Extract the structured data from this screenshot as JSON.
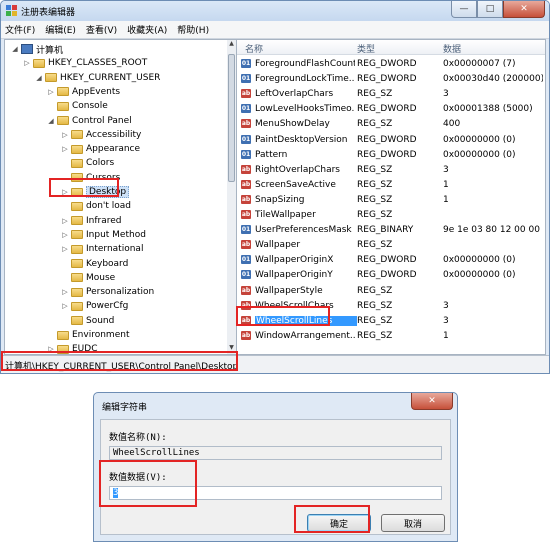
{
  "window": {
    "title": "注册表编辑器",
    "buttons": {
      "minimize": "—",
      "maximize": "□",
      "close": "✕"
    }
  },
  "menu": [
    "文件(F)",
    "编辑(E)",
    "查看(V)",
    "收藏夹(A)",
    "帮助(H)"
  ],
  "tree": [
    {
      "label": "计算机",
      "expander": "◢",
      "icon": "computer-icon"
    },
    {
      "label": "HKEY_CLASSES_ROOT",
      "expander": "▷",
      "icon": "folder-icon"
    },
    {
      "label": "HKEY_CURRENT_USER",
      "expander": "◢",
      "icon": "folder-icon"
    },
    {
      "label": "AppEvents",
      "expander": "▷",
      "icon": "folder-icon"
    },
    {
      "label": "Console",
      "expander": "",
      "icon": "folder-icon"
    },
    {
      "label": "Control Panel",
      "expander": "◢",
      "icon": "folder-icon"
    },
    {
      "label": "Accessibility",
      "expander": "▷",
      "icon": "folder-icon"
    },
    {
      "label": "Appearance",
      "expander": "▷",
      "icon": "folder-icon"
    },
    {
      "label": "Colors",
      "expander": "",
      "icon": "folder-icon"
    },
    {
      "label": "Cursors",
      "expander": "",
      "icon": "folder-icon"
    },
    {
      "label": "Desktop",
      "expander": "▷",
      "icon": "folder-icon",
      "selected": true
    },
    {
      "label": "don't load",
      "expander": "",
      "icon": "folder-icon"
    },
    {
      "label": "Infrared",
      "expander": "▷",
      "icon": "folder-icon"
    },
    {
      "label": "Input Method",
      "expander": "▷",
      "icon": "folder-icon"
    },
    {
      "label": "International",
      "expander": "▷",
      "icon": "folder-icon"
    },
    {
      "label": "Keyboard",
      "expander": "",
      "icon": "folder-icon"
    },
    {
      "label": "Mouse",
      "expander": "",
      "icon": "folder-icon"
    },
    {
      "label": "Personalization",
      "expander": "▷",
      "icon": "folder-icon"
    },
    {
      "label": "PowerCfg",
      "expander": "▷",
      "icon": "folder-icon"
    },
    {
      "label": "Sound",
      "expander": "",
      "icon": "folder-icon"
    },
    {
      "label": "Environment",
      "expander": "",
      "icon": "folder-icon"
    },
    {
      "label": "EUDC",
      "expander": "▷",
      "icon": "folder-icon"
    }
  ],
  "list": {
    "columns": {
      "name": "名称",
      "type": "类型",
      "data": "数据"
    },
    "rows": [
      {
        "icon": "binary-value-icon",
        "name": "ForegroundFlashCount",
        "type": "REG_DWORD",
        "data": "0x00000007 (7)"
      },
      {
        "icon": "binary-value-icon",
        "name": "ForegroundLockTime...",
        "type": "REG_DWORD",
        "data": "0x00030d40 (200000)"
      },
      {
        "icon": "string-value-icon",
        "name": "LeftOverlapChars",
        "type": "REG_SZ",
        "data": "3"
      },
      {
        "icon": "binary-value-icon",
        "name": "LowLevelHooksTimeo...",
        "type": "REG_DWORD",
        "data": "0x00001388 (5000)"
      },
      {
        "icon": "string-value-icon",
        "name": "MenuShowDelay",
        "type": "REG_SZ",
        "data": "400"
      },
      {
        "icon": "binary-value-icon",
        "name": "PaintDesktopVersion",
        "type": "REG_DWORD",
        "data": "0x00000000 (0)"
      },
      {
        "icon": "binary-value-icon",
        "name": "Pattern",
        "type": "REG_DWORD",
        "data": "0x00000000 (0)"
      },
      {
        "icon": "string-value-icon",
        "name": "RightOverlapChars",
        "type": "REG_SZ",
        "data": "3"
      },
      {
        "icon": "string-value-icon",
        "name": "ScreenSaveActive",
        "type": "REG_SZ",
        "data": "1"
      },
      {
        "icon": "string-value-icon",
        "name": "SnapSizing",
        "type": "REG_SZ",
        "data": "1"
      },
      {
        "icon": "string-value-icon",
        "name": "TileWallpaper",
        "type": "REG_SZ",
        "data": ""
      },
      {
        "icon": "binary-value-icon",
        "name": "UserPreferencesMask",
        "type": "REG_BINARY",
        "data": "9e 1e 03 80 12 00 00"
      },
      {
        "icon": "string-value-icon",
        "name": "Wallpaper",
        "type": "REG_SZ",
        "data": ""
      },
      {
        "icon": "binary-value-icon",
        "name": "WallpaperOriginX",
        "type": "REG_DWORD",
        "data": "0x00000000 (0)"
      },
      {
        "icon": "binary-value-icon",
        "name": "WallpaperOriginY",
        "type": "REG_DWORD",
        "data": "0x00000000 (0)"
      },
      {
        "icon": "string-value-icon",
        "name": "WallpaperStyle",
        "type": "REG_SZ",
        "data": ""
      },
      {
        "icon": "string-value-icon",
        "name": "WheelScrollChars",
        "type": "REG_SZ",
        "data": "3"
      },
      {
        "icon": "string-value-icon",
        "name": "WheelScrollLines",
        "type": "REG_SZ",
        "data": "3",
        "selected": true
      },
      {
        "icon": "string-value-icon",
        "name": "WindowArrangement...",
        "type": "REG_SZ",
        "data": "1"
      }
    ]
  },
  "status": {
    "path": "计算机\\HKEY_CURRENT_USER\\Control Panel\\Desktop"
  },
  "dialog": {
    "title": "编辑字符串",
    "close_symbol": "✕",
    "name_label": "数值名称(N):",
    "name_value": "WheelScrollLines",
    "data_label": "数值数据(V):",
    "data_value": "3",
    "ok_label": "确定",
    "cancel_label": "取消"
  },
  "colors": {
    "highlight_box": "#e32424",
    "selection": "#3399ff"
  }
}
